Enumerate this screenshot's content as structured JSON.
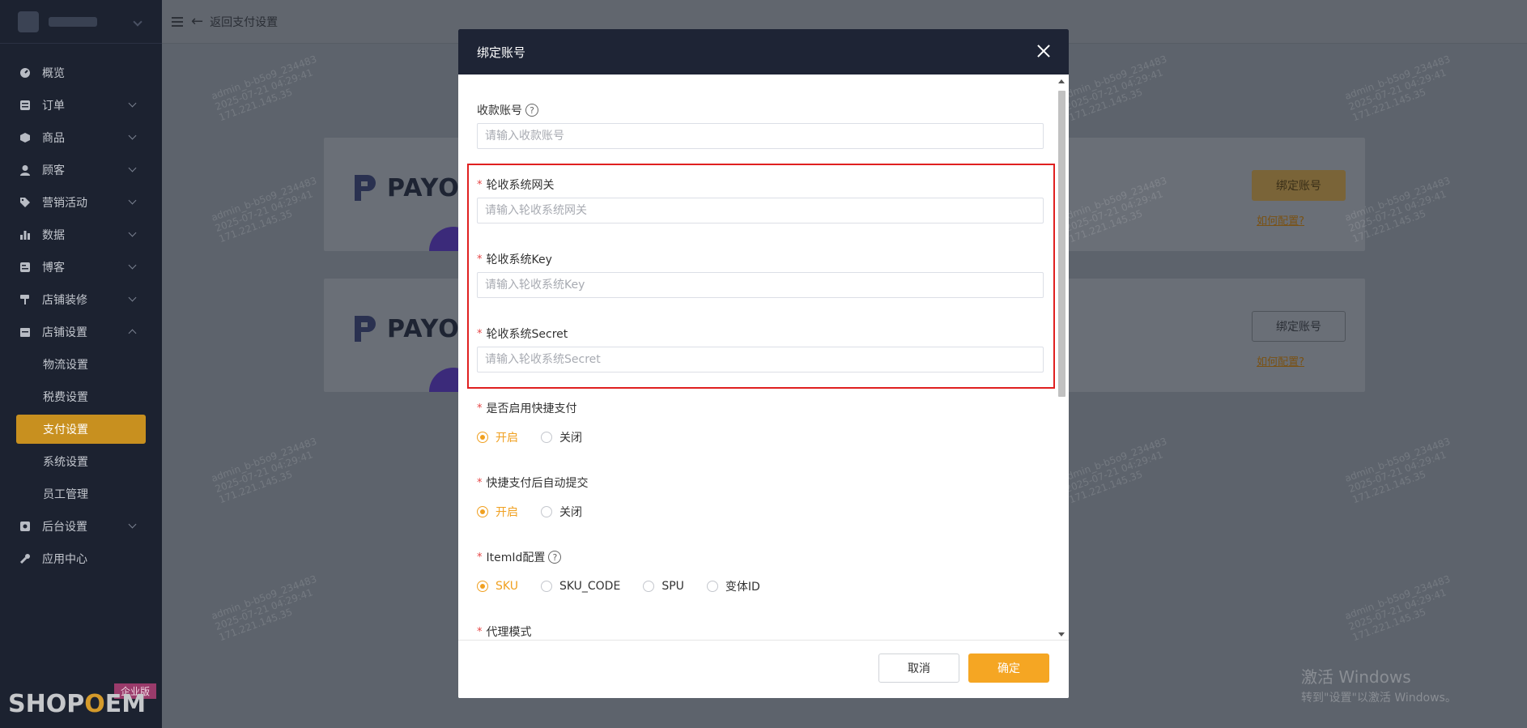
{
  "header": {
    "back_label": "返回支付设置"
  },
  "sidebar": {
    "items": [
      {
        "label": "概览"
      },
      {
        "label": "订单"
      },
      {
        "label": "商品"
      },
      {
        "label": "顾客"
      },
      {
        "label": "营销活动"
      },
      {
        "label": "数据"
      },
      {
        "label": "博客"
      },
      {
        "label": "店铺装修"
      },
      {
        "label": "店铺设置"
      },
      {
        "label": "后台设置"
      },
      {
        "label": "应用中心"
      }
    ],
    "sub_items": [
      {
        "label": "物流设置"
      },
      {
        "label": "税费设置"
      },
      {
        "label": "支付设置"
      },
      {
        "label": "系统设置"
      },
      {
        "label": "员工管理"
      }
    ],
    "brand": "SHOPOEM",
    "badge": "企业版"
  },
  "cards": [
    {
      "logo_text": "PAYOI",
      "button": "绑定账号",
      "help_link": "如何配置?"
    },
    {
      "logo_text": "PAYOI",
      "button": "绑定账号",
      "help_link": "如何配置?"
    }
  ],
  "modal": {
    "title": "绑定账号",
    "fields": {
      "account": {
        "label": "收款账号",
        "placeholder": "请输入收款账号"
      },
      "gateway": {
        "label": "轮收系统网关",
        "placeholder": "请输入轮收系统网关"
      },
      "key": {
        "label": "轮收系统Key",
        "placeholder": "请输入轮收系统Key"
      },
      "secret": {
        "label": "轮收系统Secret",
        "placeholder": "请输入轮收系统Secret"
      }
    },
    "quick_pay": {
      "label": "是否启用快捷支付",
      "options": [
        "开启",
        "关闭"
      ],
      "selected": "开启"
    },
    "auto_submit": {
      "label": "快捷支付后自动提交",
      "options": [
        "开启",
        "关闭"
      ],
      "selected": "开启"
    },
    "item_id": {
      "label": "ItemId配置",
      "options": [
        "SKU",
        "SKU_CODE",
        "SPU",
        "变体ID"
      ],
      "selected": "SKU"
    },
    "proxy_mode": {
      "label": "代理模式"
    },
    "cancel_label": "取消",
    "confirm_label": "确定"
  },
  "watermark": {
    "line1": "admin_b-b5o9_234483",
    "line2": "2025-07-21 04:29:41",
    "line3": "171.221.145.35"
  },
  "windows_activation": {
    "title": "激活 Windows",
    "subtitle": "转到\"设置\"以激活 Windows。"
  }
}
